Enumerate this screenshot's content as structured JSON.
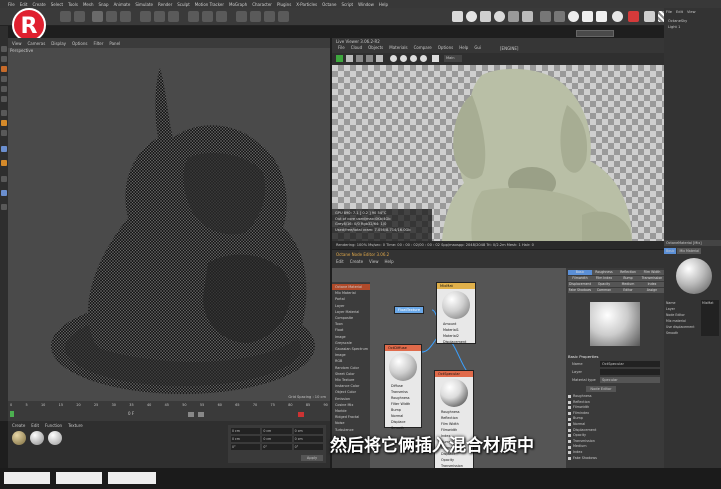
{
  "app": {
    "logo_letter": "R",
    "menu": [
      "File",
      "Edit",
      "Create",
      "Select",
      "Tools",
      "Mesh",
      "Snap",
      "Animate",
      "Simulate",
      "Render",
      "Sculpt",
      "Motion Tracker",
      "MoGraph",
      "Character",
      "Plugins",
      "X-Particles",
      "Octane",
      "Script",
      "Window",
      "Help"
    ]
  },
  "viewport": {
    "menu": [
      "View",
      "Cameras",
      "Display",
      "Options",
      "Filter",
      "Panel"
    ],
    "label": "Perspective",
    "grid_spacing": "Grid Spacing : 10 cm"
  },
  "live_viewer": {
    "title": "Live Viewer 3.06.2-R2",
    "menu": [
      "File",
      "Cloud",
      "Objects",
      "Materials",
      "Compare",
      "Options",
      "Help",
      "Gui"
    ],
    "mode_label": "[ENGINE]",
    "channel": "Main",
    "stats": [
      "GPU 890: 7.1  [  0.2  ]        90       54°C",
      "Out of core used/max:0Kb/4Gb",
      "Grey8/16: 0/0           Rgb32/64: 1/0",
      "Used/free/total vram: 7.056/8.714/16.0Gb"
    ],
    "status": "Rendering: 100%  Ms/sec: 0   Time: 00 : 00 : 02/00 : 00 : 02   Spp/maxspp: 2048/2048   Tri: 0/2.2m   Mesh: 1   Hair: 0"
  },
  "node_editor": {
    "title": "Octane Node Editor 3.06.2",
    "menu": [
      "Edit",
      "Create",
      "View",
      "Help"
    ],
    "tab": "Get Filter Nd",
    "filter_tabs": [
      "Mat",
      "Tex",
      "Gen",
      "Map",
      "Oth",
      "Emi",
      "Med",
      "C4D"
    ],
    "list": [
      "Octane Material",
      "Mix Material",
      "Portal",
      "Layer",
      "Layer Material",
      "Composite",
      "Toon",
      "Float",
      "Image",
      "Greyscale",
      "Gaussian Spectrum",
      "Image",
      "RGB",
      "Random Color",
      "Sheet Color",
      "Mix Texture",
      "Instance Color",
      "Object Color",
      "Emission",
      "Cosine Mix",
      "Marble",
      "Ridged Fractal",
      "Noise",
      "Turbulence"
    ],
    "nodes": {
      "mix": {
        "title": "MixMat",
        "ports": [
          "Amount",
          "Material1",
          "Material2",
          "Displacement"
        ]
      },
      "float": {
        "title": "FloatTexture"
      },
      "diffuse": {
        "title": "OctDiffuse",
        "ports": [
          "Diffuse",
          "Transmiss",
          "Roughness",
          "Filter Width",
          "Bump",
          "Normal",
          "Displace",
          "Smooth"
        ]
      },
      "specular": {
        "title": "OctSpecular",
        "ports": [
          "Roughness",
          "Reflection",
          "Film Width",
          "Filmwidth",
          "Index",
          "Bump",
          "Normal",
          "Displace",
          "Opacity",
          "Transmission",
          "Medium"
        ]
      }
    }
  },
  "attributes": {
    "tabs": [
      "Basic",
      "Roughness",
      "Reflection",
      "Film Width",
      "Filmwidth",
      "Film Index",
      "Bump",
      "Transmission",
      "Displacement",
      "Opacity",
      "Medium",
      "Index",
      "Fake Shadows",
      "Common",
      "Editor",
      "Assign"
    ],
    "section": "Basic Properties",
    "name_label": "Name",
    "name_value": "OctSpecular",
    "layer_label": "Layer",
    "type_label": "Material type",
    "type_value": "Specular",
    "button": "Node Editor",
    "props": [
      "Roughness",
      "Reflection",
      "Filmwidth",
      "Filmindex",
      "Bump",
      "Normal",
      "Displacement",
      "Opacity",
      "Transmission",
      "Medium",
      "Index",
      "Fake Shadows"
    ]
  },
  "right_panel": {
    "menu": [
      "File",
      "Edit",
      "View"
    ],
    "objects": [
      "OctaneSky",
      "Light 1"
    ],
    "attr_title": "OctaneMaterial [Mix]",
    "tabs": [
      "Basic",
      "Mix Material"
    ],
    "props": [
      "Name",
      "Layer",
      "Node Editor",
      "Mix material",
      "Use displacement",
      "Smooth"
    ],
    "prop_values": [
      "MixMat",
      "",
      "",
      "",
      "",
      ""
    ]
  },
  "materials": {
    "menu": [
      "Create",
      "Edit",
      "Function",
      "Texture"
    ]
  },
  "coords": {
    "values": [
      "0 cm",
      "0 cm",
      "0 cm",
      "0 cm",
      "0 cm",
      "0 cm",
      "0°",
      "0°",
      "0°"
    ],
    "apply_button": "Apply"
  },
  "timeline": {
    "ticks": [
      "0",
      "5",
      "10",
      "15",
      "20",
      "25",
      "30",
      "35",
      "40",
      "45",
      "50",
      "55",
      "60",
      "65",
      "70",
      "75",
      "80",
      "85",
      "90"
    ],
    "frame": "0 F"
  },
  "subtitle": "然后将它俩插入混合材质中",
  "colors": {
    "logo_red": "#e0202f",
    "active_tab_blue": "#5b8fd6",
    "node_wire": "#3aa0ff",
    "render_statue": "#b9bfa6"
  }
}
